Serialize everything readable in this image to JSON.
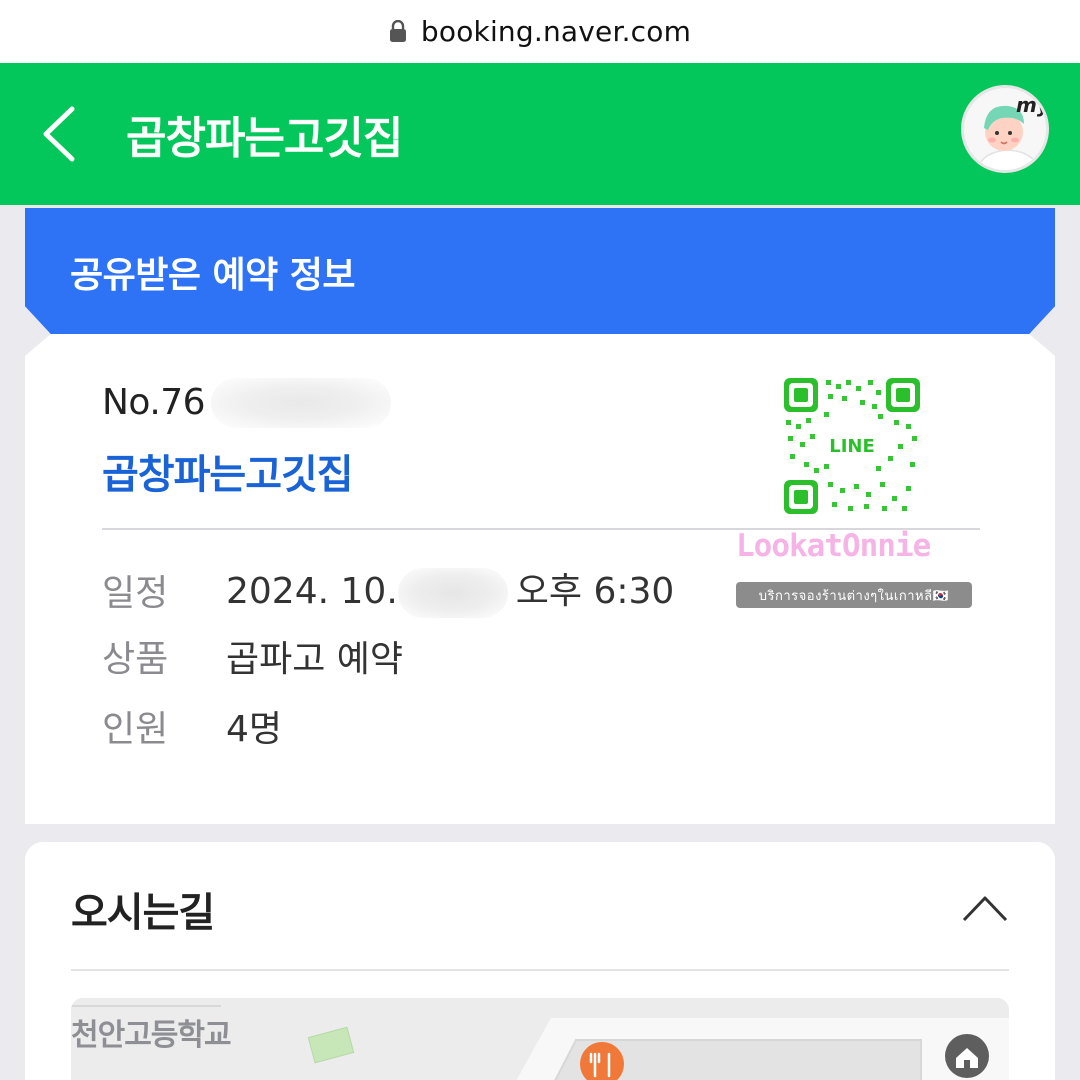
{
  "browser": {
    "url": "booking.naver.com"
  },
  "header": {
    "title": "곱창파는고깃집",
    "avatar_label": "my"
  },
  "banner": {
    "title": "공유받은 예약 정보"
  },
  "reservation": {
    "number_visible": "No.76",
    "restaurant": "곱창파는고깃집",
    "rows": [
      {
        "label": "일정",
        "value_prefix": "2024. 10.",
        "value_suffix": "오후 6:30"
      },
      {
        "label": "상품",
        "value": "곱파고 예약"
      },
      {
        "label": "인원",
        "value": "4명"
      }
    ]
  },
  "watermark": {
    "qr_label": "LINE",
    "brand": "LookatOnnie",
    "caption": "บริการจองร้านต่างๆในเกาหลี🇰🇷"
  },
  "directions": {
    "title": "오시는길",
    "map_label": "천안고등학교"
  },
  "colors": {
    "header_green": "#03c75a",
    "banner_blue": "#2e73f6",
    "restaurant_blue": "#1a63d6",
    "watermark_pink": "#f6b4e6",
    "map_pin_orange": "#f07838"
  }
}
